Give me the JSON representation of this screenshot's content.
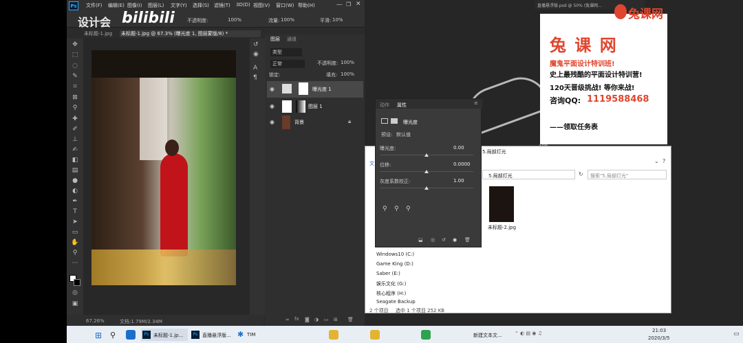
{
  "watermark": {
    "left": "设计会",
    "right": "bilibili"
  },
  "ps": {
    "logo": "Ps",
    "menu": [
      "文件(F)",
      "编辑(E)",
      "图像(I)",
      "图层(L)",
      "文字(Y)",
      "选择(S)",
      "滤镜(T)",
      "3D(D)",
      "视图(V)",
      "窗口(W)",
      "帮助(H)"
    ],
    "options": {
      "opacity_label": "不透明度:",
      "opacity_value": "100%",
      "flow_label": "流量:",
      "flow_value": "100%",
      "smooth_label": "平滑:",
      "smooth_value": "10%"
    },
    "tabs": [
      "未标题-1.jpg",
      "未标题-1.jpg @ 67.3% (曝光度 1, 图层蒙版/8) *"
    ],
    "status": {
      "zoom": "67.26%",
      "doc": "文档:1.79M/2.34M"
    },
    "layers_panel": {
      "tabs": [
        "图层",
        "通道"
      ],
      "filter": "类型",
      "blend": "正常",
      "opacity_label": "不透明度:",
      "opacity_value": "100%",
      "lock_label": "锁定:",
      "fill_label": "填充:",
      "fill_value": "100%",
      "layers": [
        {
          "name": "曝光度 1"
        },
        {
          "name": "图层 1"
        },
        {
          "name": "背景"
        }
      ]
    }
  },
  "properties": {
    "tabs": [
      "动作",
      "属性"
    ],
    "title": "曝光度",
    "preset_label": "预设:",
    "preset_value": "默认值",
    "exposure_label": "曝光度:",
    "exposure_value": "0.00",
    "exposure_level": 0.5,
    "offset_label": "位移:",
    "offset_value": "0.0000",
    "offset_level": 0.5,
    "gamma_label": "灰度系数校正:",
    "gamma_value": "1.00",
    "gamma_level": 0.5
  },
  "explorer": {
    "path_top": "5.局部灯光",
    "address": "5.局部灯光",
    "search_placeholder": "搜索\"5.局部灯光\"",
    "drives": [
      "Windows10 (C:)",
      "Game King (D:)",
      "Saber (E:)",
      "娱乐文化 (G:)",
      "核心程序 (H:)",
      "Seagate Backup"
    ],
    "file_name": "未标题-2.jpg",
    "status": [
      "2 个项目",
      "选中 1 个项目 252 KB"
    ],
    "top_left_label": "文"
  },
  "second_window": {
    "title": "直播悬浮版.psd @ 50% (兔课网...",
    "zoom": "50%"
  },
  "ad": {
    "brand_top": "兔课网",
    "brand": "兔 课 网",
    "line1": "魔鬼平面设计特训班!",
    "line2": "史上最残酷的平面设计特训营!",
    "line3": "120天晋级挑战! 等你来战!",
    "qq_label": "咨询QQ:",
    "qq_number": "1119588468",
    "task": "——领取任务表"
  },
  "taskbar": {
    "items": [
      "未标题-1.jp...",
      "直播悬浮版...",
      "TIM",
      "新建文本文..."
    ],
    "time": "21:03",
    "date": "2020/3/5"
  },
  "colors": {
    "accent_red": "#e0452e",
    "ps_blue": "#31a8ff"
  }
}
